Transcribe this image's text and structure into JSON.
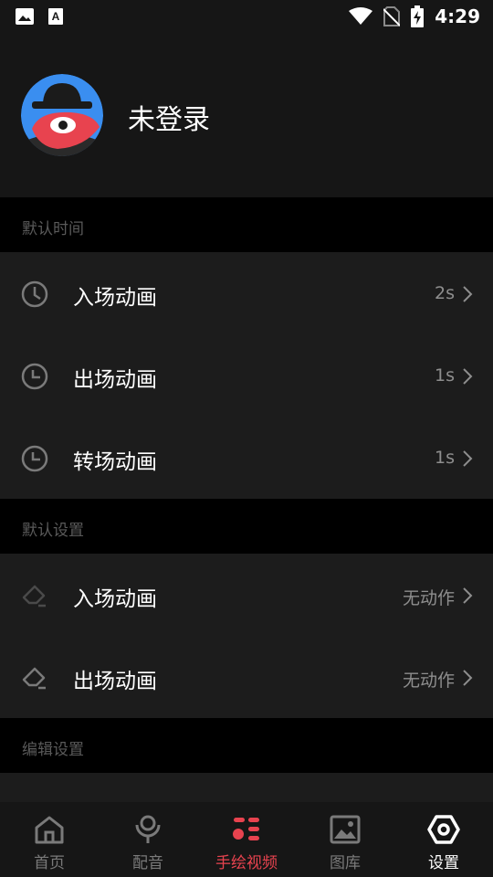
{
  "status_bar": {
    "time": "4:29",
    "icons": [
      "image-notification-icon",
      "font-notification-icon",
      "wifi-icon",
      "no-sim-icon",
      "battery-charging-icon"
    ]
  },
  "profile": {
    "username": "未登录",
    "avatar_icon": "spy-avatar-icon"
  },
  "sections": {
    "time": {
      "header": "默认时间",
      "rows": [
        {
          "label": "入场动画",
          "value": "2s",
          "icon": "clock-icon"
        },
        {
          "label": "出场动画",
          "value": "1s",
          "icon": "clock-icon"
        },
        {
          "label": "转场动画",
          "value": "1s",
          "icon": "clock-icon"
        }
      ]
    },
    "settings": {
      "header": "默认设置",
      "rows": [
        {
          "label": "入场动画",
          "value": "无动作",
          "icon": "eraser-icon"
        },
        {
          "label": "出场动画",
          "value": "无动作",
          "icon": "eraser-icon"
        }
      ]
    },
    "edit": {
      "header": "编辑设置"
    }
  },
  "tabbar": {
    "tabs": [
      {
        "label": "首页",
        "icon": "home-icon"
      },
      {
        "label": "配音",
        "icon": "microphone-icon"
      },
      {
        "label": "手绘视频",
        "icon": "hand-draw-icon",
        "active": true
      },
      {
        "label": "图库",
        "icon": "gallery-icon"
      },
      {
        "label": "设置",
        "icon": "settings-hexagon-icon",
        "selected": true
      }
    ]
  },
  "colors": {
    "background": "#161616",
    "section_header": "#000000",
    "row": "#1c1c1c",
    "accent": "#e8434f",
    "muted": "#8e8e8e"
  }
}
